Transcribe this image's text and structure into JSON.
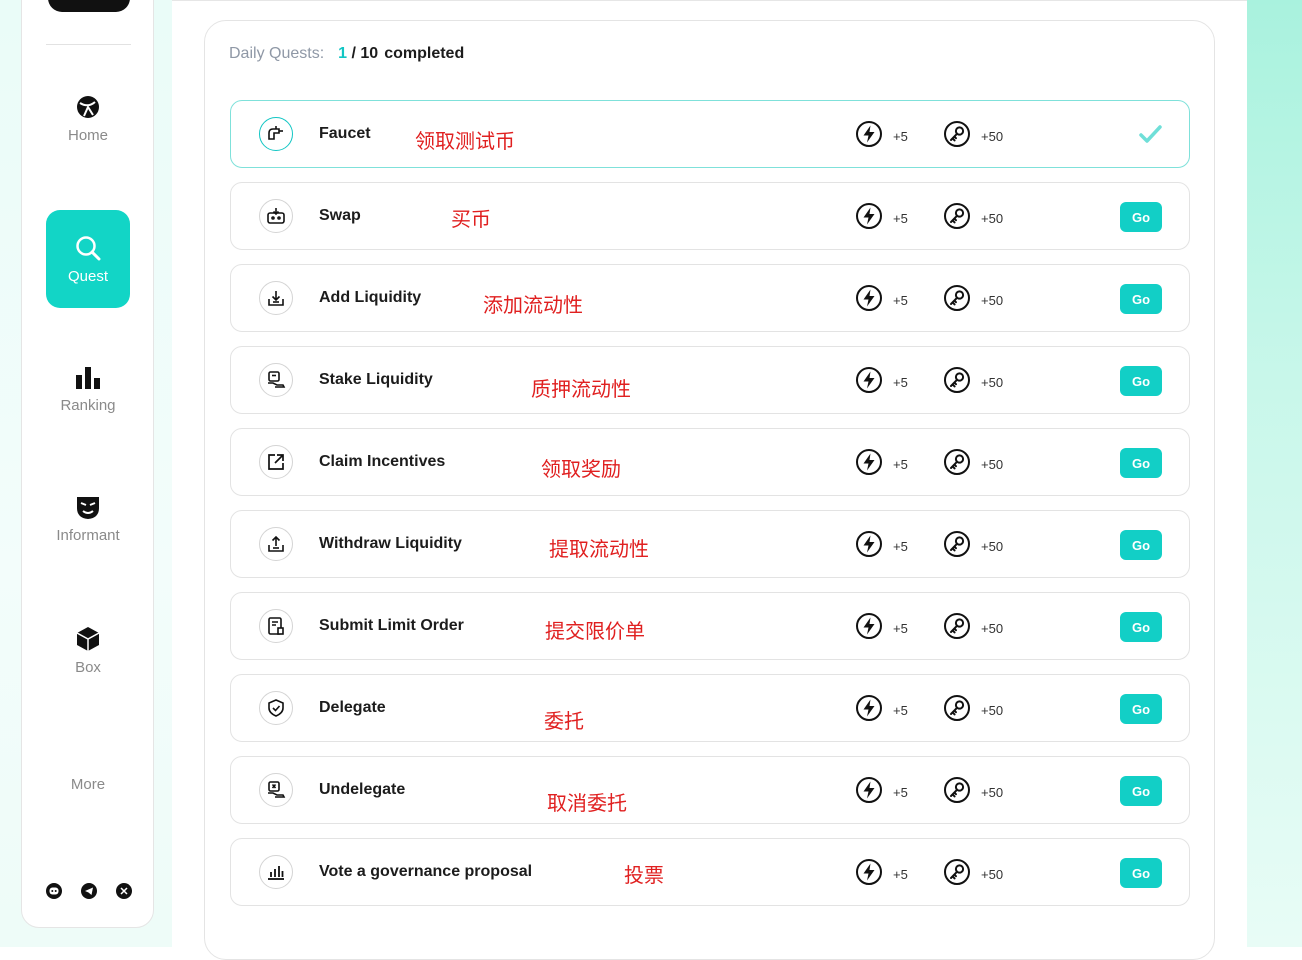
{
  "nav": {
    "items": [
      {
        "label": "Home",
        "icon": "globe-icon"
      },
      {
        "label": "Quest",
        "icon": "search-icon"
      },
      {
        "label": "Ranking",
        "icon": "bar-chart-icon"
      },
      {
        "label": "Informant",
        "icon": "mask-icon"
      },
      {
        "label": "Box",
        "icon": "cube-icon"
      }
    ],
    "more": "More",
    "socials": [
      "discord-icon",
      "telegram-icon",
      "x-icon"
    ]
  },
  "progress": {
    "label": "Daily Quests:",
    "done": "1",
    "sep": "/",
    "total": "10",
    "suffix": "completed"
  },
  "rewards": {
    "energy": "+5",
    "key": "+50"
  },
  "go_label": "Go",
  "quests": [
    {
      "name": "Faucet",
      "note": "领取测试币",
      "status": "completed",
      "icon": "faucet-icon"
    },
    {
      "name": "Swap",
      "note": "买币",
      "status": "pending",
      "icon": "swap-icon"
    },
    {
      "name": "Add Liquidity",
      "note": "添加流动性",
      "status": "pending",
      "icon": "download-tray-icon"
    },
    {
      "name": "Stake Liquidity",
      "note": "质押流动性",
      "status": "pending",
      "icon": "stake-hand-icon"
    },
    {
      "name": "Claim Incentives",
      "note": "领取奖励",
      "status": "pending",
      "icon": "external-link-icon"
    },
    {
      "name": "Withdraw Liquidity",
      "note": "提取流动性",
      "status": "pending",
      "icon": "upload-tray-icon"
    },
    {
      "name": "Submit Limit Order",
      "note": "提交限价单",
      "status": "pending",
      "icon": "order-sheet-icon"
    },
    {
      "name": "Delegate",
      "note": "委托",
      "status": "pending",
      "icon": "shield-check-icon"
    },
    {
      "name": "Undelegate",
      "note": "取消委托",
      "status": "pending",
      "icon": "undelegate-hand-icon"
    },
    {
      "name": "Vote a governance proposal",
      "note": "投票",
      "status": "pending",
      "icon": "vote-bars-icon"
    }
  ],
  "colors": {
    "accent": "#12cfc6",
    "note": "#e02020"
  }
}
